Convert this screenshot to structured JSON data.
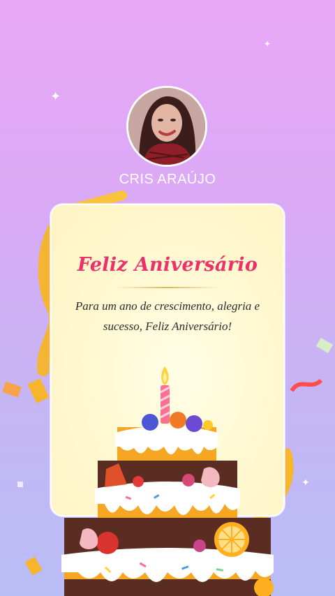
{
  "profile": {
    "name": "CRIS ARAÚJO"
  },
  "card": {
    "title": "Feliz Aniversário",
    "message_line1": "Para um ano de crescimento, alegria e",
    "message_line2": "sucesso, Feliz Aniversário!"
  },
  "colors": {
    "title": "#ee2f6a",
    "background_top": "#e9a8f7",
    "background_bottom": "#b9bdf6",
    "card": "#fff8cf"
  }
}
